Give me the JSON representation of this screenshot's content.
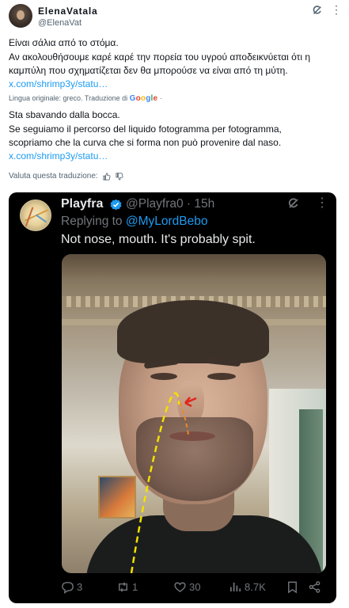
{
  "tweet": {
    "display_name": "ElenaVatala",
    "handle": "@ElenaVat",
    "original_text_1": "Είναι σάλια από το στόμα.",
    "original_text_2": "Αν ακολουθήσουμε καρέ καρέ την πορεία του υγρού αποδεικνύεται ότι η",
    "original_text_3": "καμπύλη που σχηματίζεται δεν θα μπορούσε να είναι από τη μύτη.",
    "link_1": "x.com/shrimp3y/statu…",
    "lang_label": "Lingua originale: greco. Traduzione di",
    "google": "Google",
    "lang_tail": "·",
    "translated_1": "Sta sbavando dalla bocca.",
    "translated_2": "Se seguiamo il percorso del liquido fotogramma per fotogramma,",
    "translated_3": "scopriamo che la curva che si forma non può provenire dal naso.",
    "link_2": "x.com/shrimp3y/statu…",
    "rate_label": "Valuta questa traduzione:"
  },
  "quoted": {
    "name": "Playfra",
    "handle_time": "@Playfra0 · 15h",
    "replying_prefix": "Replying to",
    "replying_mention": "@MyLordBebo",
    "text": "Not nose, mouth. It's probably spit.",
    "replies": "3",
    "reposts": "1",
    "likes": "30",
    "views": "8.7K"
  },
  "icons": {
    "grok": "grok-icon",
    "more": "more-icon",
    "verified": "verified-badge-icon",
    "reply": "reply-icon",
    "repost": "repost-icon",
    "like": "heart-icon",
    "views": "views-icon",
    "bookmark": "bookmark-icon",
    "share": "share-icon"
  },
  "colors": {
    "link": "#1d9bf0",
    "card_bg": "#000000",
    "annotation_line": "#f2e000",
    "annotation_arrow": "#e0261b"
  }
}
